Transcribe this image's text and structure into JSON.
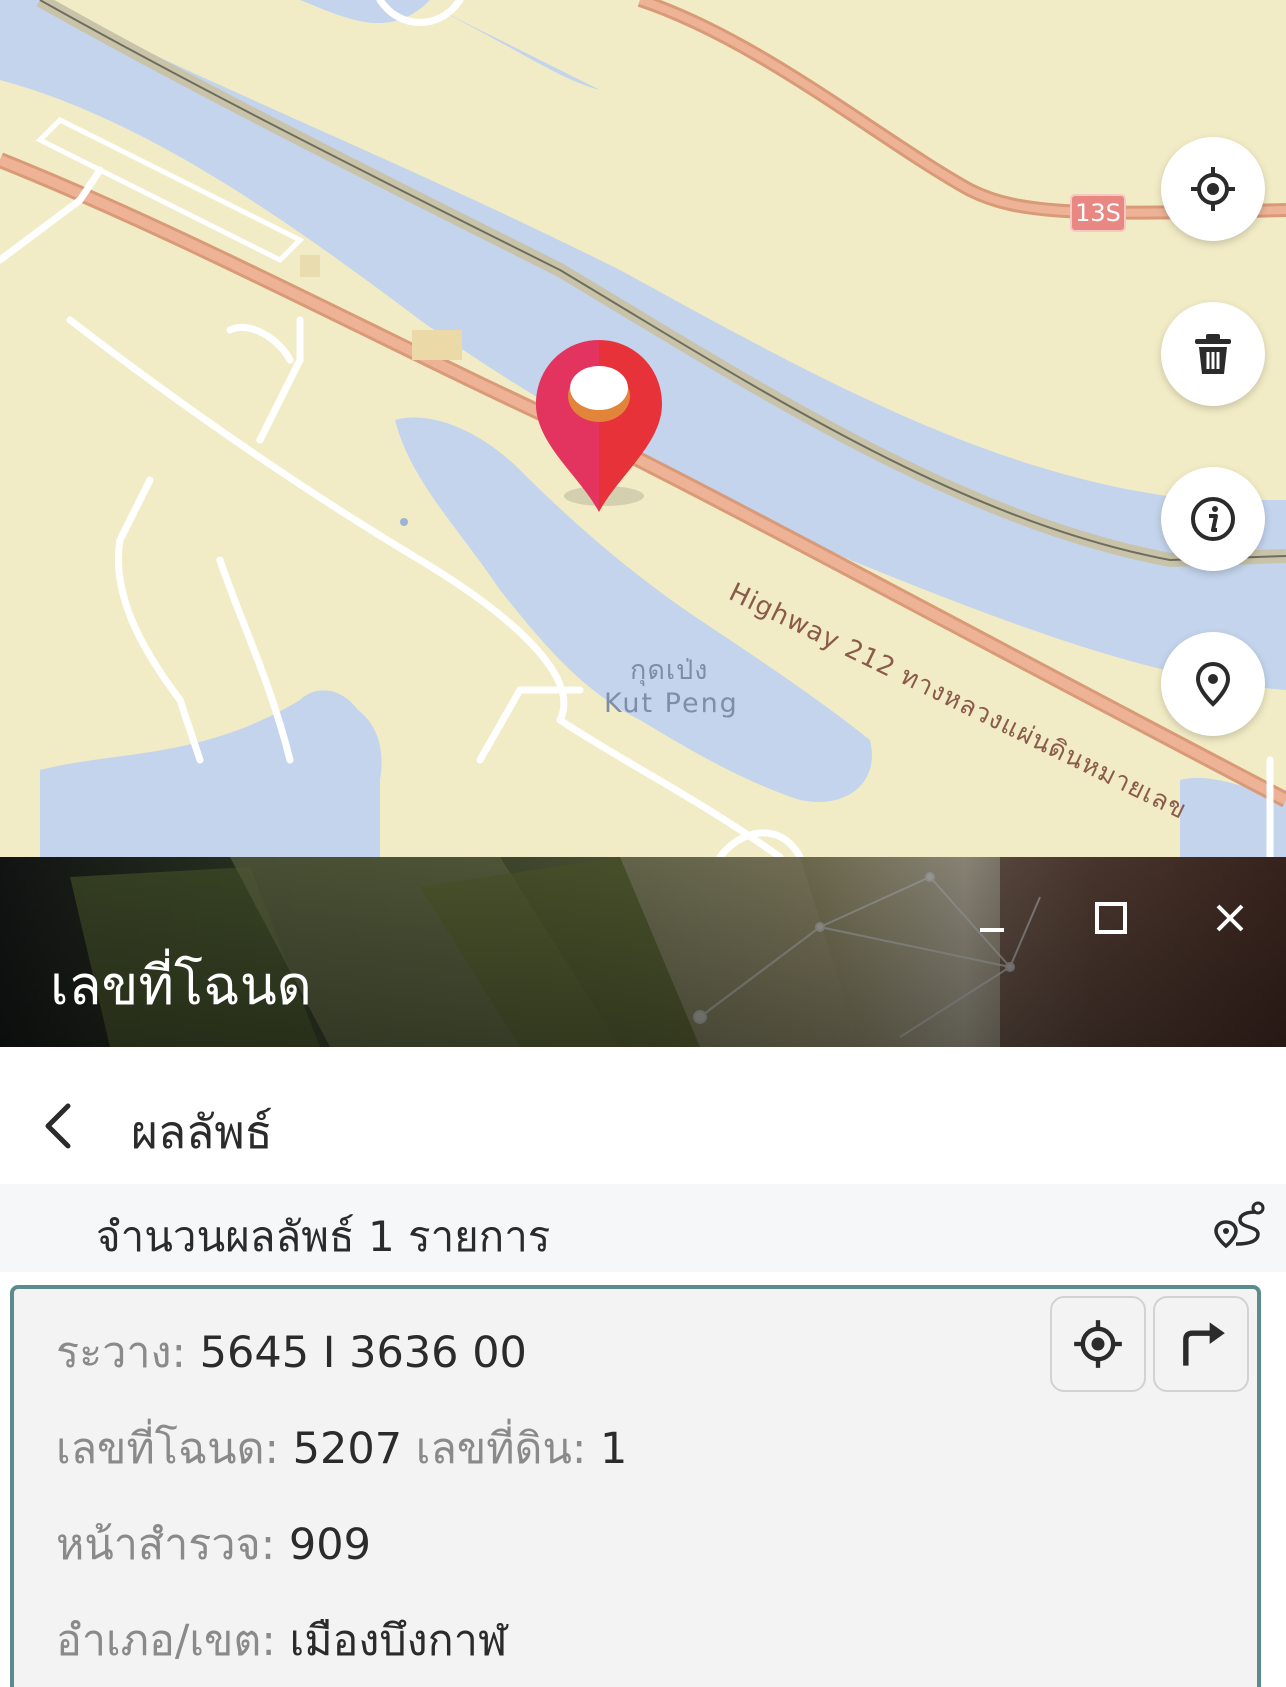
{
  "map": {
    "place_label_th": "กุดเป่ง",
    "place_label_en": "Kut Peng",
    "road_label": "Highway 212 ทางหลวงแผ่นดินหมายเลข",
    "route_shield": "13S",
    "controls": [
      {
        "name": "locate-me",
        "icon": "crosshair-icon"
      },
      {
        "name": "delete",
        "icon": "trash-icon"
      },
      {
        "name": "info",
        "icon": "info-icon"
      },
      {
        "name": "pin",
        "icon": "map-pin-icon"
      }
    ],
    "marker_color": "#e8323a"
  },
  "panel": {
    "title": "เลขที่โฉนด",
    "buttons": [
      {
        "name": "minimize",
        "icon": "minimize-icon"
      },
      {
        "name": "maximize",
        "icon": "maximize-icon"
      },
      {
        "name": "close",
        "icon": "close-icon"
      }
    ]
  },
  "results": {
    "back_icon": "chevron-left-icon",
    "title": "ผลลัพธ์",
    "count_text": "จำนวนผลลัพธ์ 1 รายการ",
    "route_icon": "route-icon"
  },
  "result": {
    "fields": [
      {
        "label": "ระวาง:",
        "value": "5645 I 3636 00"
      },
      {
        "label": "เลขที่โฉนด:",
        "value": "5207",
        "label2": "เลขที่ดิน:",
        "value2": "1"
      },
      {
        "label": "หน้าสำรวจ:",
        "value": "909"
      },
      {
        "label": "อำเภอ/เขต:",
        "value": "เมืองบึงกาฬ"
      }
    ],
    "buttons": [
      {
        "name": "zoom-to",
        "icon": "crosshair-icon"
      },
      {
        "name": "directions",
        "icon": "turn-right-icon"
      }
    ]
  },
  "colors": {
    "accent_border": "#5b8b8c",
    "water": "#c3d4ec",
    "land": "#f2ecc6",
    "road": "#e8a98a"
  }
}
